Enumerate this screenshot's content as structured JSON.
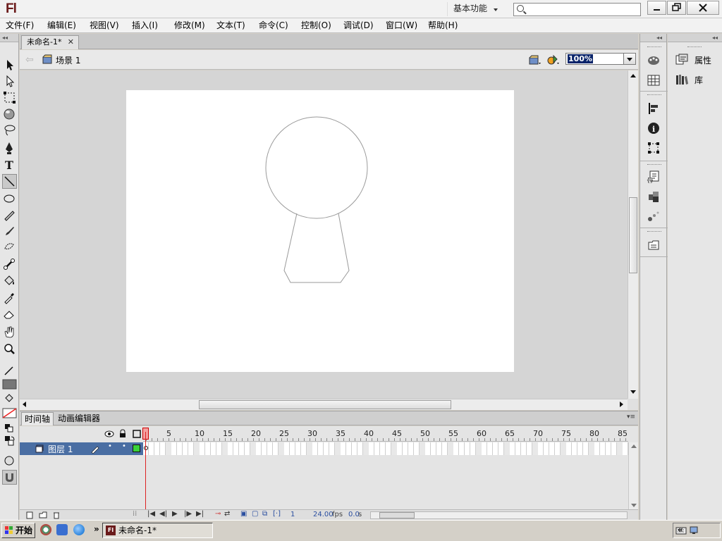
{
  "app": {
    "logo": "Fl",
    "workspace": "基本功能",
    "search_placeholder": "",
    "window_controls": [
      "minimize-icon",
      "restore-icon",
      "close-icon"
    ]
  },
  "menu": [
    "文件(F)",
    "编辑(E)",
    "视图(V)",
    "插入(I)",
    "修改(M)",
    "文本(T)",
    "命令(C)",
    "控制(O)",
    "调试(D)",
    "窗口(W)",
    "帮助(H)"
  ],
  "document": {
    "tab_title": "未命名-1*",
    "scene": "场景 1",
    "zoom": "100%"
  },
  "timeline": {
    "tabs": [
      "时间轴",
      "动画编辑器"
    ],
    "layer_name": "图层 1",
    "frame_numbers": [
      "5",
      "10",
      "15",
      "20",
      "25",
      "30",
      "35",
      "40",
      "45",
      "50",
      "55",
      "60",
      "65",
      "70",
      "75",
      "80",
      "85"
    ],
    "current_frame": "1",
    "fps": "24.00",
    "fps_unit": "fps",
    "elapsed": "0.0",
    "elapsed_unit": "s"
  },
  "panels": {
    "properties": "属性",
    "library": "库"
  },
  "taskbar": {
    "start": "开始",
    "task": "未命名-1*"
  },
  "colors": {
    "layer_highlight": "#4a6ea3",
    "playhead": "#dd2222",
    "stage": "#ffffff",
    "workspace_bg": "#d5d5d5"
  }
}
